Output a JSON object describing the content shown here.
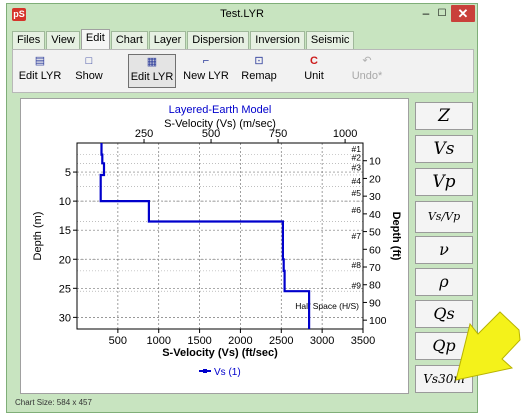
{
  "window": {
    "title": "Test.LYR",
    "app_badge": "pS",
    "min_glyph": "–",
    "max_glyph": "☐",
    "close_glyph": "✕"
  },
  "menu": {
    "tabs": [
      {
        "label": "Files"
      },
      {
        "label": "View"
      },
      {
        "label": "Edit"
      },
      {
        "label": "Chart"
      },
      {
        "label": "Layer"
      },
      {
        "label": "Dispersion"
      },
      {
        "label": "Inversion"
      },
      {
        "label": "Seismic"
      }
    ],
    "active": "Edit"
  },
  "toolbar": {
    "buttons": [
      {
        "label": "Edit LYR",
        "icon": "edit-lyr-icon",
        "glyph": "▤"
      },
      {
        "label": "Show",
        "icon": "show-icon",
        "glyph": "□"
      },
      {
        "label": "Edit LYR",
        "icon": "table-icon",
        "glyph": "▦"
      },
      {
        "label": "New LYR",
        "icon": "new-lyr-icon",
        "glyph": "⌐"
      },
      {
        "label": "Remap",
        "icon": "remap-icon",
        "glyph": "⊡"
      },
      {
        "label": "Unit",
        "icon": "unit-icon",
        "glyph": "C"
      },
      {
        "label": "Undo*",
        "icon": "undo-icon",
        "glyph": "↶"
      }
    ]
  },
  "side_buttons": [
    {
      "label": "Z"
    },
    {
      "label": "Vs"
    },
    {
      "label": "Vp"
    },
    {
      "label": "Vs/Vp"
    },
    {
      "label": "ν"
    },
    {
      "label": "ρ"
    },
    {
      "label": "Qs"
    },
    {
      "label": "Qp"
    },
    {
      "label": "Vs30m"
    }
  ],
  "status": {
    "text": "Chart Size: 584 x 457"
  },
  "colors": {
    "series": "#0000cc",
    "title": "#0000cc",
    "close": "#c9403a",
    "arrow": "#f4f21a",
    "window_bg": "#c8e4c0"
  },
  "chart_data": {
    "type": "line",
    "title": "Layered-Earth Model",
    "top_axis_label": "S-Velocity (Vs) (m/sec)",
    "top_ticks": [
      250,
      500,
      750,
      1000
    ],
    "xlabel": "S-Velocity (Vs) (ft/sec)",
    "x_ticks": [
      500,
      1000,
      1500,
      2000,
      2500,
      3000,
      3500
    ],
    "xlim": [
      0,
      3500
    ],
    "ylabel": "Depth (m)",
    "y_ticks": [
      5,
      10,
      15,
      20,
      25,
      30
    ],
    "ylim": [
      0,
      32
    ],
    "y2label": "Depth (ft)",
    "y2_ticks": [
      10,
      20,
      30,
      40,
      50,
      60,
      70,
      80,
      90,
      100
    ],
    "grid": true,
    "layer_labels": [
      {
        "label": "#1",
        "depth_m": 1.0
      },
      {
        "label": "#2",
        "depth_m": 2.5
      },
      {
        "label": "#3",
        "depth_m": 4.2
      },
      {
        "label": "#4",
        "depth_m": 6.5
      },
      {
        "label": "#5",
        "depth_m": 8.6
      },
      {
        "label": "#6",
        "depth_m": 11.5
      },
      {
        "label": "#7",
        "depth_m": 16.0
      },
      {
        "label": "#8",
        "depth_m": 21.0
      },
      {
        "label": "#9",
        "depth_m": 24.5
      }
    ],
    "layer_boundaries_m": [
      2.0,
      3.5,
      5.5,
      7.5,
      10.0,
      13.5,
      20.0,
      22.0,
      25.5
    ],
    "halfspace_label": "Half Space (H/S)",
    "series": [
      {
        "name": "Vs (1)",
        "points": [
          {
            "v": 300,
            "d": 0
          },
          {
            "v": 300,
            "d": 2.0
          },
          {
            "v": 310,
            "d": 2.0
          },
          {
            "v": 310,
            "d": 3.5
          },
          {
            "v": 330,
            "d": 3.5
          },
          {
            "v": 330,
            "d": 5.5
          },
          {
            "v": 290,
            "d": 5.5
          },
          {
            "v": 290,
            "d": 10.0
          },
          {
            "v": 880,
            "d": 10.0
          },
          {
            "v": 880,
            "d": 13.5
          },
          {
            "v": 2520,
            "d": 13.5
          },
          {
            "v": 2520,
            "d": 20.0
          },
          {
            "v": 2530,
            "d": 20.0
          },
          {
            "v": 2530,
            "d": 22.0
          },
          {
            "v": 2540,
            "d": 22.0
          },
          {
            "v": 2540,
            "d": 25.5
          },
          {
            "v": 2840,
            "d": 25.5
          },
          {
            "v": 2840,
            "d": 32
          }
        ]
      }
    ]
  }
}
